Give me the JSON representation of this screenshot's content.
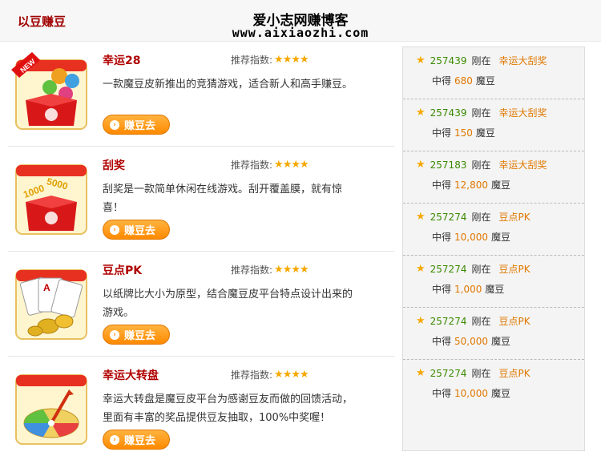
{
  "header": {
    "section_title": "以豆赚豆",
    "watermark_title": "爱小志网赚博客",
    "watermark_url": "www.aixiaozhi.com"
  },
  "games": [
    {
      "name": "幸运28",
      "rating_label": "推荐指数:",
      "stars": "★★★★",
      "desc": "一款魔豆皮新推出的竞猜游戏，适合新人和高手赚豆。",
      "button": "赚豆去",
      "icon": "lucky28-game-icon"
    },
    {
      "name": "刮奖",
      "rating_label": "推荐指数:",
      "stars": "★★★★",
      "desc": "刮奖是一款简单休闲在线游戏。刮开覆盖膜，就有惊喜！",
      "button": "赚豆去",
      "icon": "scratch-card-icon"
    },
    {
      "name": "豆点PK",
      "rating_label": "推荐指数:",
      "stars": "★★★★",
      "desc": "以纸牌比大小为原型，结合魔豆皮平台特点设计出来的游戏。",
      "button": "赚豆去",
      "icon": "cards-coins-icon"
    },
    {
      "name": "幸运大转盘",
      "rating_label": "推荐指数:",
      "stars": "★★★★",
      "desc": "幸运大转盘是魔豆皮平台为感谢豆友而做的回馈活动，里面有丰富的奖品提供豆友抽取，100%中奖喔！",
      "button": "赚豆去",
      "icon": "wheel-icon"
    }
  ],
  "feed": [
    {
      "user": "257439",
      "at": "刚在",
      "game": "幸运大刮奖",
      "win": "中得",
      "amount": "680",
      "unit": "魔豆"
    },
    {
      "user": "257439",
      "at": "刚在",
      "game": "幸运大刮奖",
      "win": "中得",
      "amount": "150",
      "unit": "魔豆"
    },
    {
      "user": "257183",
      "at": "刚在",
      "game": "幸运大刮奖",
      "win": "中得",
      "amount": "12,800",
      "unit": "魔豆"
    },
    {
      "user": "257274",
      "at": "刚在",
      "game": "豆点PK",
      "win": "中得",
      "amount": "10,000",
      "unit": "魔豆"
    },
    {
      "user": "257274",
      "at": "刚在",
      "game": "豆点PK",
      "win": "中得",
      "amount": "1,000",
      "unit": "魔豆"
    },
    {
      "user": "257274",
      "at": "刚在",
      "game": "豆点PK",
      "win": "中得",
      "amount": "50,000",
      "unit": "魔豆"
    },
    {
      "user": "257274",
      "at": "刚在",
      "game": "豆点PK",
      "win": "中得",
      "amount": "10,000",
      "unit": "魔豆"
    }
  ],
  "colors": {
    "accent_red": "#b00000",
    "button_orange": "#ff8a00",
    "user_green": "#3a8a00",
    "star_gold": "#f5a800"
  }
}
